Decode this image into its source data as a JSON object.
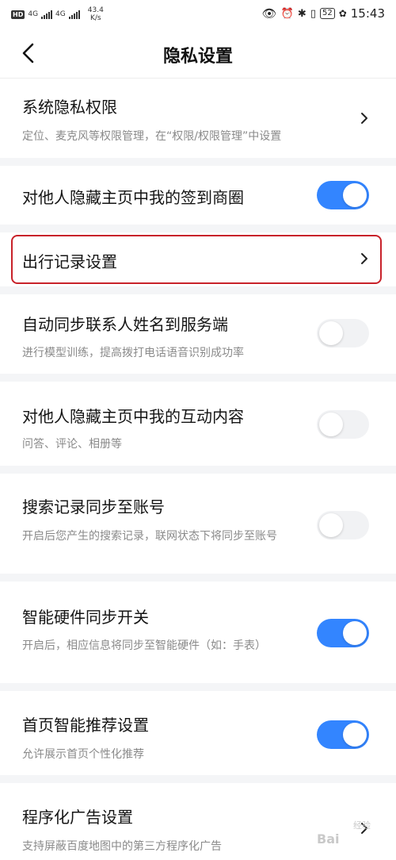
{
  "status_bar": {
    "network_label": "4G",
    "speed_value": "43.4",
    "speed_unit": "K/s",
    "battery": "52",
    "time": "15:43"
  },
  "nav": {
    "title": "隐私设置"
  },
  "settings": [
    {
      "title": "系统隐私权限",
      "subtitle": "定位、麦克风等权限管理，在“权限/权限管理”中设置",
      "control": "chevron"
    },
    {
      "title": "对他人隐藏主页中我的签到商圈",
      "subtitle": "",
      "control": "toggle",
      "enabled": true
    },
    {
      "title": "出行记录设置",
      "subtitle": "",
      "control": "chevron"
    },
    {
      "title": "自动同步联系人姓名到服务端",
      "subtitle": "进行模型训练，提高拨打电话语音识别成功率",
      "control": "toggle",
      "enabled": false
    },
    {
      "title": "对他人隐藏主页中我的互动内容",
      "subtitle": "问答、评论、相册等",
      "control": "toggle",
      "enabled": false
    },
    {
      "title": "搜索记录同步至账号",
      "subtitle": "开启后您产生的搜索记录，联网状态下将同步至账号",
      "control": "toggle",
      "enabled": false
    },
    {
      "title": "智能硬件同步开关",
      "subtitle": "开启后，相应信息将同步至智能硬件（如：手表）",
      "control": "toggle",
      "enabled": true
    },
    {
      "title": "首页智能推荐设置",
      "subtitle": "允许展示首页个性化推荐",
      "control": "toggle",
      "enabled": true
    },
    {
      "title": "程序化广告设置",
      "subtitle": "支持屏蔽百度地图中的第三方程序化广告",
      "control": "chevron"
    }
  ],
  "colors": {
    "accent": "#3385ff",
    "highlight": "#c8222a",
    "background": "#f4f5f7"
  },
  "watermark": {
    "text": "Bai",
    "sub": "经验"
  }
}
